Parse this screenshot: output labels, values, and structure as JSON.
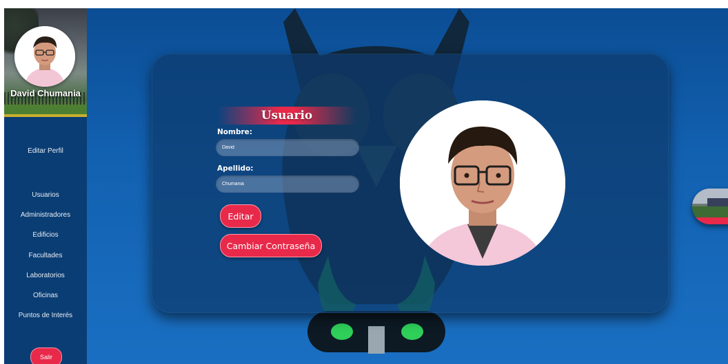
{
  "user": {
    "name": "David Chumania"
  },
  "sidebar": {
    "edit_profile": "Editar Perfil",
    "items": [
      {
        "label": "Usuarios"
      },
      {
        "label": "Administradores"
      },
      {
        "label": "Edificios"
      },
      {
        "label": "Facultades"
      },
      {
        "label": "Laboratorios"
      },
      {
        "label": "Oficinas"
      },
      {
        "label": "Puntos de Interés"
      }
    ],
    "logout_label": "Salir"
  },
  "form": {
    "title": "Usuario",
    "first_name_label": "Nombre:",
    "first_name_value": "David",
    "last_name_label": "Apellido:",
    "last_name_value": "Chumania",
    "edit_label": "Editar",
    "change_password_label": "Cambiar Contraseña"
  },
  "colors": {
    "accent": "#e8294a",
    "sidebar": "#0a3d73",
    "background": "#1260b0"
  },
  "icons": {
    "floating_button": "campus-photo-icon",
    "profile_photo": "user-photo-icon"
  }
}
